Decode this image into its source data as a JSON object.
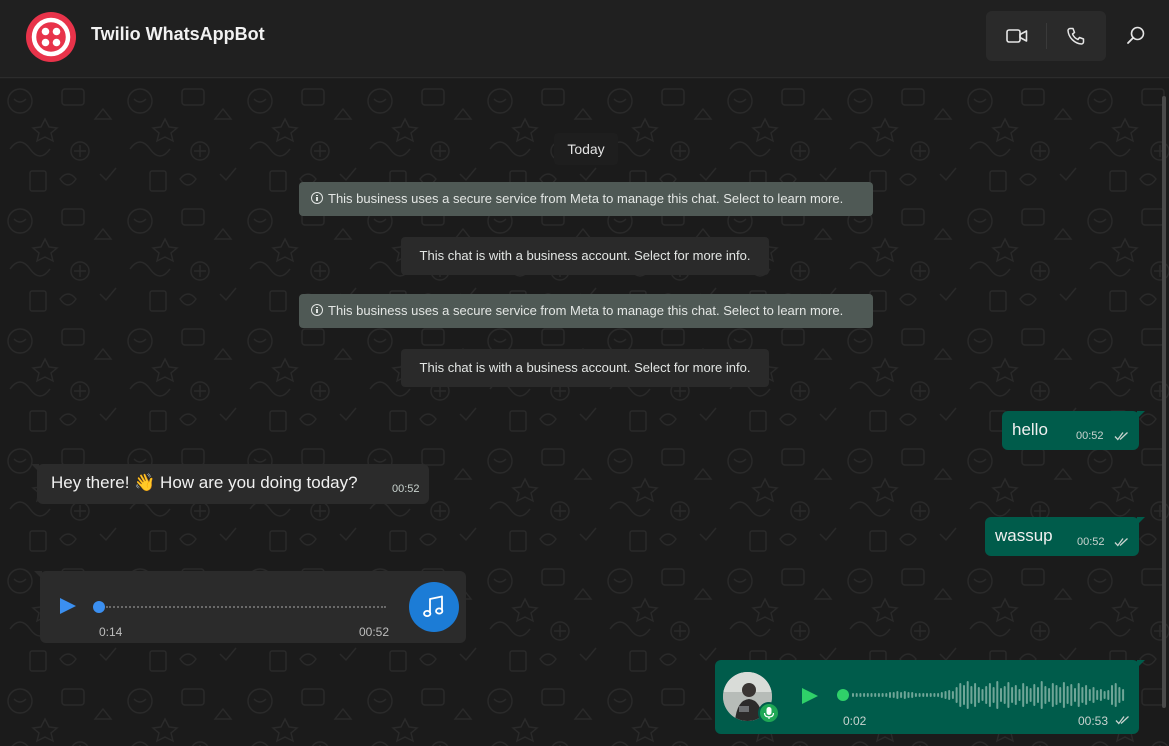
{
  "header": {
    "title": "Twilio WhatsAppBot",
    "avatar_icon": "twilio-logo-icon",
    "video_call_icon": "video-camera-icon",
    "voice_call_icon": "phone-icon",
    "search_icon": "search-icon"
  },
  "chat": {
    "date_label": "Today",
    "system_messages": [
      {
        "type": "meta",
        "text": "This business uses a secure service from Meta to manage this chat. Select to learn more."
      },
      {
        "type": "business",
        "text": "This chat is with a business account. Select for more info."
      },
      {
        "type": "meta",
        "text": "This business uses a secure service from Meta to manage this chat. Select to learn more."
      },
      {
        "type": "business",
        "text": "This chat is with a business account. Select for more info."
      }
    ],
    "messages": [
      {
        "direction": "outgoing",
        "text": "hello",
        "time": "00:52",
        "status": "read"
      },
      {
        "direction": "incoming",
        "text": "Hey there! 👋 How are you doing today?",
        "time": "00:52"
      },
      {
        "direction": "outgoing",
        "text": "wassup",
        "time": "00:52",
        "status": "read"
      }
    ],
    "audio_incoming": {
      "duration": "0:14",
      "time": "00:52",
      "icon": "music-note-icon",
      "progress": 0
    },
    "voice_outgoing": {
      "duration": "0:02",
      "time": "00:53",
      "status": "read",
      "progress": 0
    }
  },
  "colors": {
    "outgoing_bubble": "#005c4b",
    "incoming_bubble": "#2b2b2b",
    "background": "#1b1b1b",
    "accent_blue": "#1c7cd6",
    "accent_green": "#2fd069"
  }
}
